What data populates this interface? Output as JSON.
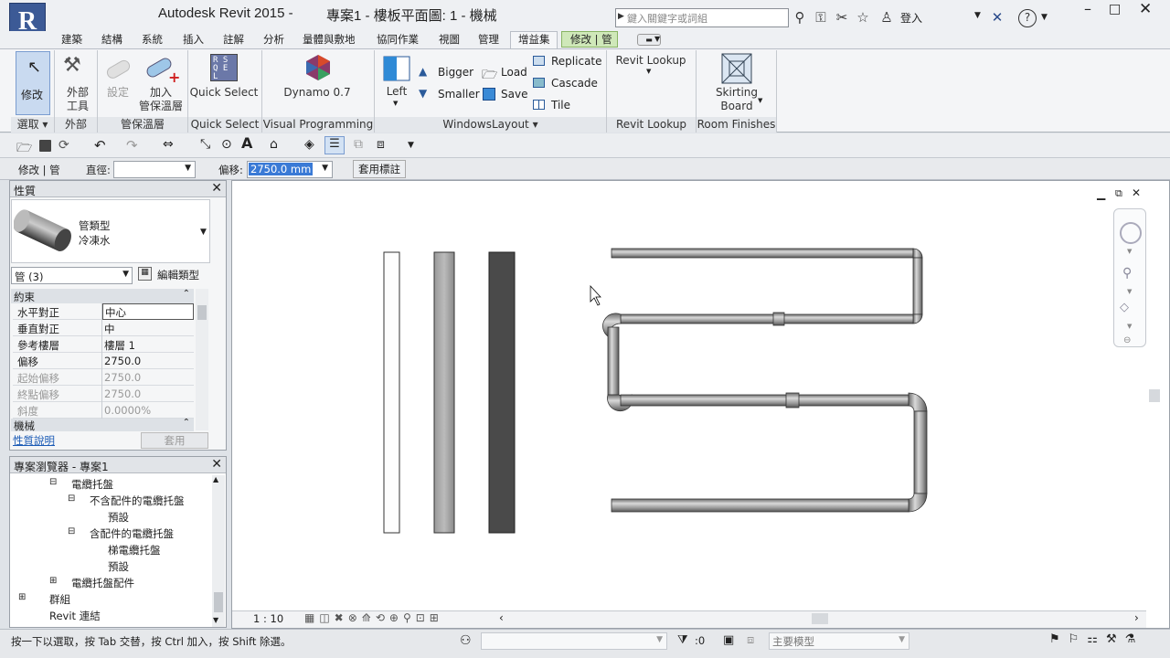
{
  "app": {
    "logo_letter": "R",
    "title": "Autodesk Revit 2015 -",
    "document": "專案1 - 樓板平面圖: 1 - 機械",
    "search_placeholder": "鍵入關鍵字或詞組",
    "login_label": "登入"
  },
  "tabs": [
    "建築",
    "結構",
    "系統",
    "插入",
    "註解",
    "分析",
    "量體與敷地",
    "協同作業",
    "視圖",
    "管理",
    "增益集",
    "修改 | 管"
  ],
  "active_tab": "增益集",
  "ribbon": {
    "modify": "修改",
    "external_tools": "外部\n工具",
    "settings": "設定",
    "add_insulation": "加入\n管保溫層",
    "quick_select": "Quick Select",
    "dynamo": "Dynamo 0.7",
    "left": "Left",
    "bigger": "Bigger",
    "smaller": "Smaller",
    "load": "Load",
    "save": "Save",
    "replicate": "Replicate",
    "cascade": "Cascade",
    "tile": "Tile",
    "revit_lookup": "Revit Lookup",
    "skirting_board": "Skirting\nBoard",
    "panels": [
      "選取 ▾",
      "外部",
      "管保溫層",
      "Quick Select",
      "Visual Programming",
      "WindowsLayout ▾",
      "Revit Lookup",
      "Room Finishes"
    ]
  },
  "options_bar": {
    "context": "修改 | 管",
    "diameter_label": "直徑:",
    "diameter_value": "",
    "offset_label": "偏移:",
    "offset_value": "2750.0 mm",
    "apply_tag": "套用標註"
  },
  "properties": {
    "title": "性質",
    "type_name": "管類型",
    "type_value": "冷凍水",
    "instance_filter": "管 (3)",
    "edit_type": "編輯類型",
    "group_constraints": "約束",
    "rows": [
      {
        "k": "水平對正",
        "v": "中心",
        "grey": false
      },
      {
        "k": "垂直對正",
        "v": "中",
        "grey": false
      },
      {
        "k": "參考樓層",
        "v": "樓層 1",
        "grey": false
      },
      {
        "k": "偏移",
        "v": "2750.0",
        "grey": false
      },
      {
        "k": "起始偏移",
        "v": "2750.0",
        "grey": true
      },
      {
        "k": "終點偏移",
        "v": "2750.0",
        "grey": true
      },
      {
        "k": "斜度",
        "v": "0.0000%",
        "grey": true
      }
    ],
    "group_mechanical": "機械",
    "help_link": "性質說明",
    "apply": "套用"
  },
  "browser": {
    "title": "專案瀏覽器 - 專案1",
    "items": [
      {
        "label": "電纜托盤",
        "indent": 1,
        "expander": "⊟"
      },
      {
        "label": "不含配件的電纜托盤",
        "indent": 2,
        "expander": "⊟"
      },
      {
        "label": "預設",
        "indent": 3,
        "expander": ""
      },
      {
        "label": "含配件的電纜托盤",
        "indent": 2,
        "expander": "⊟"
      },
      {
        "label": "梯電纜托盤",
        "indent": 3,
        "expander": ""
      },
      {
        "label": "預設",
        "indent": 3,
        "expander": ""
      },
      {
        "label": "電纜托盤配件",
        "indent": 1,
        "expander": "⊞"
      },
      {
        "label": "群組",
        "indent": 0,
        "expander": "⊞"
      },
      {
        "label": "Revit 連結",
        "indent": 0,
        "expander": ""
      }
    ]
  },
  "view": {
    "scale": "1 : 10"
  },
  "status": {
    "hint": "按一下以選取，按 Tab 交替，按 Ctrl 加入，按 Shift 除選。",
    "count": ":0",
    "workset": "主要模型"
  }
}
